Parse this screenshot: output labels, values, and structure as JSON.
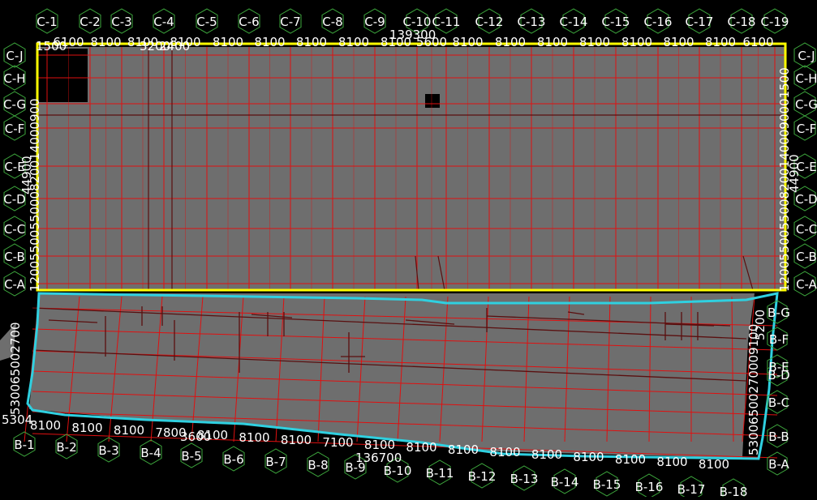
{
  "colors": {
    "background": "#000000",
    "slab": "#6e6e6e",
    "grid": "#e01010",
    "beam": "#5a0f0f",
    "hexagon": "#3ea93e",
    "building_c_outline": "#ffff00",
    "building_b_outline": "#2fd0e0",
    "text": "#ffffff"
  },
  "building_c": {
    "top_axes": [
      "C-1",
      "C-2",
      "C-3",
      "C-4",
      "C-5",
      "C-6",
      "C-7",
      "C-8",
      "C-9",
      "C-10",
      "C-11",
      "C-12",
      "C-13",
      "C-14",
      "C-15",
      "C-16",
      "C-17",
      "C-18",
      "C-19"
    ],
    "side_axes": [
      "C-J",
      "C-H",
      "C-G",
      "C-F",
      "C-E",
      "C-D",
      "C-C",
      "C-B",
      "C-A"
    ],
    "top_dimensions": [
      "6100",
      "8100",
      "8100",
      "8100",
      "8100",
      "8100",
      "8100",
      "8100",
      "8100",
      "5600",
      "8100",
      "8100",
      "8100",
      "8100",
      "8100",
      "8100",
      "8100",
      "6100"
    ],
    "total_length": "139300",
    "side_total": "44900",
    "misc_labels": {
      "top_left_corner": "1500",
      "near_c4": "3200",
      "near_c4_b": "2400",
      "left_side_dims": "1200550055000820014000900",
      "right_side_dims": "12005500550082001400090001500"
    }
  },
  "building_b": {
    "bottom_axes": [
      "B-1",
      "B-2",
      "B-3",
      "B-4",
      "B-5",
      "B-6",
      "B-7",
      "B-8",
      "B-9",
      "B-10",
      "B-11",
      "B-12",
      "B-13",
      "B-14",
      "B-15",
      "B-16",
      "B-17",
      "B-18"
    ],
    "side_axes": [
      "B-G",
      "B-F",
      "B-E",
      "B-D",
      "B-C",
      "B-B",
      "B-A"
    ],
    "bottom_dimensions": [
      "8100",
      "8100",
      "8100",
      "7800",
      "8100",
      "8100",
      "8100",
      "7100",
      "8100",
      "8100",
      "8100",
      "8100",
      "8100",
      "8100",
      "8100",
      "8100",
      "8100"
    ],
    "total_length": "136700",
    "misc_labels": {
      "left_corner": "5304",
      "left_side_dims": "530065002700",
      "near_b5": "3600",
      "right_side_dims": "53006500270009100",
      "right_side_dims_b": "5200"
    }
  }
}
